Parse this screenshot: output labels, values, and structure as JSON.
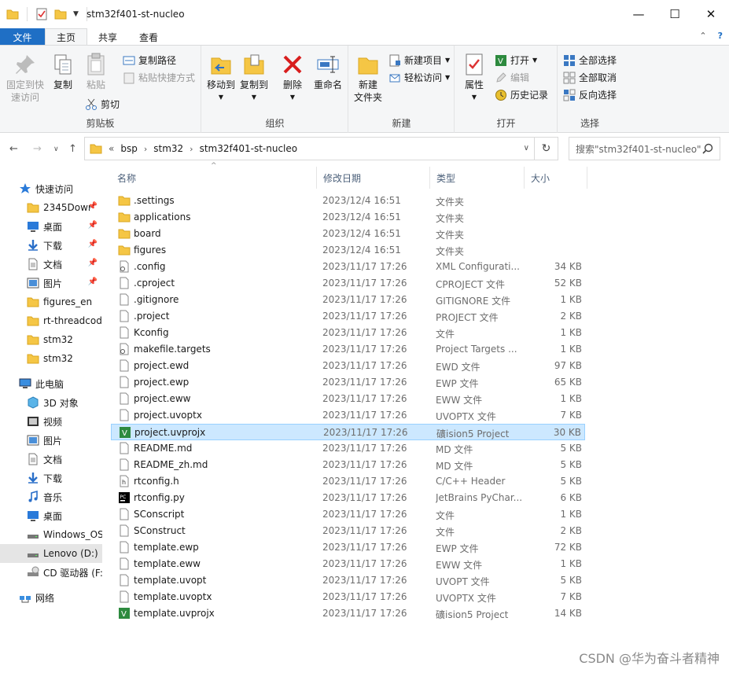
{
  "window": {
    "title": "stm32f401-st-nucleo",
    "minimize": "—",
    "maximize": "☐",
    "close": "✕"
  },
  "tabs": [
    {
      "label": "文件"
    },
    {
      "label": "主页"
    },
    {
      "label": "共享"
    },
    {
      "label": "查看"
    }
  ],
  "ribbon": {
    "clipboard": {
      "label": "剪贴板",
      "pin": "固定到快速访问",
      "copy": "复制",
      "paste": "粘贴",
      "copy_path": "复制路径",
      "paste_shortcut": "粘贴快捷方式",
      "cut": "剪切"
    },
    "organize": {
      "label": "组织",
      "move_to": "移动到",
      "copy_to": "复制到",
      "delete": "删除",
      "rename": "重命名"
    },
    "new": {
      "label": "新建",
      "new_folder": "新建\n文件夹",
      "new_item": "新建项目",
      "easy_access": "轻松访问"
    },
    "open": {
      "label": "打开",
      "properties": "属性",
      "open": "打开",
      "edit": "编辑",
      "history": "历史记录"
    },
    "select": {
      "label": "选择",
      "select_all": "全部选择",
      "select_none": "全部取消",
      "invert": "反向选择"
    }
  },
  "address": {
    "overflow": "«",
    "crumbs": [
      "bsp",
      "stm32",
      "stm32f401-st-nucleo"
    ],
    "search_placeholder": "搜索\"stm32f401-st-nucleo\""
  },
  "nav": {
    "quick_access": "快速访问",
    "items": [
      {
        "label": "2345Dowr",
        "icon": "folder-icon",
        "pinned": true
      },
      {
        "label": "桌面",
        "icon": "desktop-icon",
        "pinned": true
      },
      {
        "label": "下载",
        "icon": "download-icon",
        "pinned": true
      },
      {
        "label": "文档",
        "icon": "document-icon",
        "pinned": true
      },
      {
        "label": "图片",
        "icon": "picture-icon",
        "pinned": true
      },
      {
        "label": "figures_en",
        "icon": "folder-icon",
        "pinned": false
      },
      {
        "label": "rt-threadcod",
        "icon": "folder-icon",
        "pinned": false
      },
      {
        "label": "stm32",
        "icon": "folder-icon",
        "pinned": false
      },
      {
        "label": "stm32",
        "icon": "folder-icon",
        "pinned": false
      }
    ],
    "this_pc": "此电脑",
    "pc_items": [
      {
        "label": "3D 对象",
        "icon": "cube-icon"
      },
      {
        "label": "视频",
        "icon": "video-icon"
      },
      {
        "label": "图片",
        "icon": "picture-icon"
      },
      {
        "label": "文档",
        "icon": "document-icon"
      },
      {
        "label": "下载",
        "icon": "download-icon"
      },
      {
        "label": "音乐",
        "icon": "music-icon"
      },
      {
        "label": "桌面",
        "icon": "desktop-icon"
      },
      {
        "label": "Windows_OS",
        "icon": "drive-icon"
      },
      {
        "label": "Lenovo (D:)",
        "icon": "drive-icon"
      },
      {
        "label": "CD 驱动器 (F:",
        "icon": "cd-drive-icon"
      }
    ],
    "network": "网络"
  },
  "columns": {
    "name": "名称",
    "date": "修改日期",
    "type": "类型",
    "size": "大小",
    "sort_indicator": "^"
  },
  "files": [
    {
      "name": ".settings",
      "date": "2023/12/4 16:51",
      "type": "文件夹",
      "size": "",
      "icon": "folder-icon"
    },
    {
      "name": "applications",
      "date": "2023/12/4 16:51",
      "type": "文件夹",
      "size": "",
      "icon": "folder-icon"
    },
    {
      "name": "board",
      "date": "2023/12/4 16:51",
      "type": "文件夹",
      "size": "",
      "icon": "folder-icon"
    },
    {
      "name": "figures",
      "date": "2023/12/4 16:51",
      "type": "文件夹",
      "size": "",
      "icon": "folder-icon"
    },
    {
      "name": ".config",
      "date": "2023/11/17 17:26",
      "type": "XML Configurati...",
      "size": "34 KB",
      "icon": "config-file-icon"
    },
    {
      "name": ".cproject",
      "date": "2023/11/17 17:26",
      "type": "CPROJECT 文件",
      "size": "52 KB",
      "icon": "file-icon"
    },
    {
      "name": ".gitignore",
      "date": "2023/11/17 17:26",
      "type": "GITIGNORE 文件",
      "size": "1 KB",
      "icon": "file-icon"
    },
    {
      "name": ".project",
      "date": "2023/11/17 17:26",
      "type": "PROJECT 文件",
      "size": "2 KB",
      "icon": "file-icon"
    },
    {
      "name": "Kconfig",
      "date": "2023/11/17 17:26",
      "type": "文件",
      "size": "1 KB",
      "icon": "file-icon"
    },
    {
      "name": "makefile.targets",
      "date": "2023/11/17 17:26",
      "type": "Project Targets ...",
      "size": "1 KB",
      "icon": "config-file-icon"
    },
    {
      "name": "project.ewd",
      "date": "2023/11/17 17:26",
      "type": "EWD 文件",
      "size": "97 KB",
      "icon": "file-icon"
    },
    {
      "name": "project.ewp",
      "date": "2023/11/17 17:26",
      "type": "EWP 文件",
      "size": "65 KB",
      "icon": "file-icon"
    },
    {
      "name": "project.eww",
      "date": "2023/11/17 17:26",
      "type": "EWW 文件",
      "size": "1 KB",
      "icon": "file-icon"
    },
    {
      "name": "project.uvoptx",
      "date": "2023/11/17 17:26",
      "type": "UVOPTX 文件",
      "size": "7 KB",
      "icon": "file-icon"
    },
    {
      "name": "project.uvprojx",
      "date": "2023/11/17 17:26",
      "type": "礦ision5 Project",
      "size": "30 KB",
      "icon": "keil-project-icon",
      "selected": true
    },
    {
      "name": "README.md",
      "date": "2023/11/17 17:26",
      "type": "MD 文件",
      "size": "5 KB",
      "icon": "file-icon"
    },
    {
      "name": "README_zh.md",
      "date": "2023/11/17 17:26",
      "type": "MD 文件",
      "size": "5 KB",
      "icon": "file-icon"
    },
    {
      "name": "rtconfig.h",
      "date": "2023/11/17 17:26",
      "type": "C/C++ Header",
      "size": "5 KB",
      "icon": "header-file-icon"
    },
    {
      "name": "rtconfig.py",
      "date": "2023/11/17 17:26",
      "type": "JetBrains PyChar...",
      "size": "6 KB",
      "icon": "pycharm-icon"
    },
    {
      "name": "SConscript",
      "date": "2023/11/17 17:26",
      "type": "文件",
      "size": "1 KB",
      "icon": "file-icon"
    },
    {
      "name": "SConstruct",
      "date": "2023/11/17 17:26",
      "type": "文件",
      "size": "2 KB",
      "icon": "file-icon"
    },
    {
      "name": "template.ewp",
      "date": "2023/11/17 17:26",
      "type": "EWP 文件",
      "size": "72 KB",
      "icon": "file-icon"
    },
    {
      "name": "template.eww",
      "date": "2023/11/17 17:26",
      "type": "EWW 文件",
      "size": "1 KB",
      "icon": "file-icon"
    },
    {
      "name": "template.uvopt",
      "date": "2023/11/17 17:26",
      "type": "UVOPT 文件",
      "size": "5 KB",
      "icon": "file-icon"
    },
    {
      "name": "template.uvoptx",
      "date": "2023/11/17 17:26",
      "type": "UVOPTX 文件",
      "size": "7 KB",
      "icon": "file-icon"
    },
    {
      "name": "template.uvprojx",
      "date": "2023/11/17 17:26",
      "type": "礦ision5 Project",
      "size": "14 KB",
      "icon": "keil-project-icon"
    }
  ],
  "watermark": "CSDN @华为奋斗者精神",
  "colors": {
    "accent": "#1f6fc5",
    "folder": "#f5c645",
    "selection": "#cce8ff",
    "selection_border": "#99d1ff"
  }
}
